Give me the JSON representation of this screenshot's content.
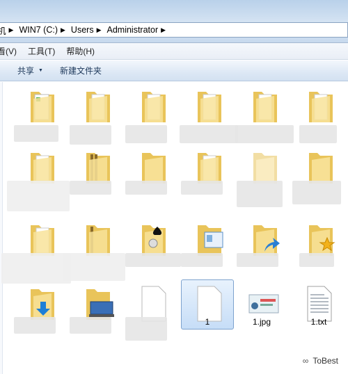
{
  "address": {
    "crumbs": [
      "机",
      "WIN7 (C:)",
      "Users",
      "Administrator"
    ]
  },
  "menu": {
    "items": [
      "看(V)",
      "工具(T)",
      "帮助(H)"
    ]
  },
  "commands": {
    "share": "共享",
    "new_folder": "新建文件夹"
  },
  "files": [
    {
      "label": "1",
      "type": "blank-file",
      "selected": true
    },
    {
      "label": "1.jpg",
      "type": "image-file",
      "selected": false
    },
    {
      "label": "1.txt",
      "type": "text-file",
      "selected": false
    }
  ],
  "watermark": {
    "text": "ToBest"
  },
  "colors": {
    "folder": "#f5d97a",
    "selection": "#c6ddf7",
    "address_bg": "#b9d1ea"
  }
}
